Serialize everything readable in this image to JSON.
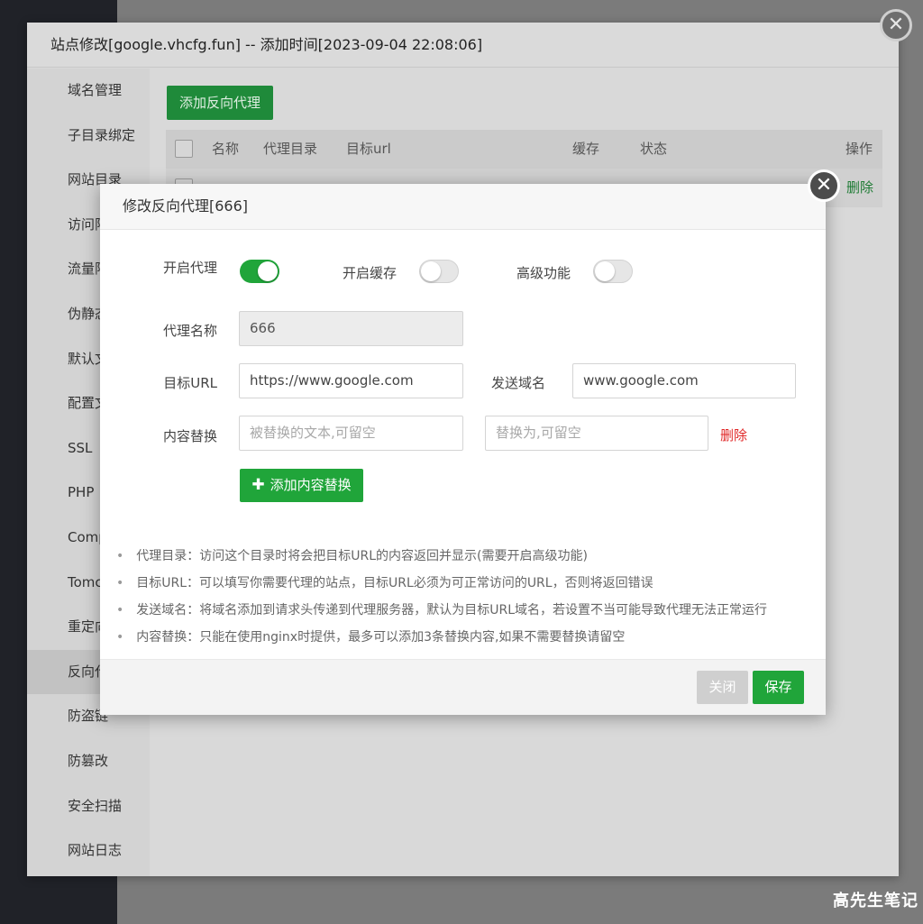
{
  "outer_modal": {
    "title": "站点修改[google.vhcfg.fun] -- 添加时间[2023-09-04 22:08:06]",
    "close_glyph": "✕",
    "sidebar": [
      {
        "label": "域名管理"
      },
      {
        "label": "子目录绑定"
      },
      {
        "label": "网站目录"
      },
      {
        "label": "访问限"
      },
      {
        "label": "流量限"
      },
      {
        "label": "伪静态"
      },
      {
        "label": "默认文"
      },
      {
        "label": "配置文"
      },
      {
        "label": "SSL"
      },
      {
        "label": "PHP"
      },
      {
        "label": "Comp"
      },
      {
        "label": "Tomc"
      },
      {
        "label": "重定向"
      },
      {
        "label": "反向代"
      },
      {
        "label": "防盗链"
      },
      {
        "label": "防篡改"
      },
      {
        "label": "安全扫描"
      },
      {
        "label": "网站日志"
      }
    ],
    "active_sidebar_index": 13,
    "add_proxy_label": "添加反向代理",
    "table": {
      "headers": [
        "名称",
        "代理目录",
        "目标url",
        "缓存",
        "状态",
        "操作"
      ],
      "row_delete_label": "删除"
    }
  },
  "inner_modal": {
    "title": "修改反向代理[666]",
    "close_glyph": "✕",
    "enable_proxy_label": "开启代理",
    "enable_proxy_on": true,
    "enable_cache_label": "开启缓存",
    "enable_cache_on": false,
    "advanced_label": "高级功能",
    "advanced_on": false,
    "proxy_name_label": "代理名称",
    "proxy_name_value": "666",
    "target_url_label": "目标URL",
    "target_url_value": "https://www.google.com",
    "send_domain_label": "发送域名",
    "send_domain_value": "www.google.com",
    "content_replace_label": "内容替换",
    "replace_from_placeholder": "被替换的文本,可留空",
    "replace_to_placeholder": "替换为,可留空",
    "replace_delete_label": "删除",
    "add_replace_label": "添加内容替换",
    "tips": [
      "代理目录：访问这个目录时将会把目标URL的内容返回并显示(需要开启高级功能)",
      "目标URL：可以填写你需要代理的站点，目标URL必须为可正常访问的URL，否则将返回错误",
      "发送域名：将域名添加到请求头传递到代理服务器，默认为目标URL域名，若设置不当可能导致代理无法正常运行",
      "内容替换：只能在使用nginx时提供，最多可以添加3条替换内容,如果不需要替换请留空"
    ],
    "close_label": "关闭",
    "save_label": "保存"
  },
  "watermark": "高先生笔记",
  "colors": {
    "primary_green": "#20a53a",
    "danger_red": "#e02828",
    "overlay_gray": "#7b7b7b"
  }
}
